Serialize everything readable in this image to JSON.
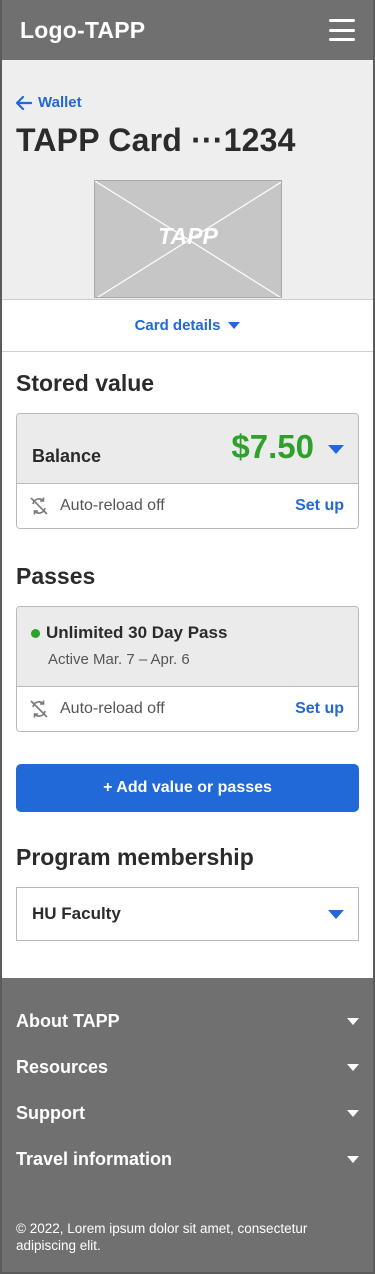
{
  "header": {
    "logo": "Logo-TAPP",
    "menu_icon": "hamburger-menu-icon"
  },
  "hero": {
    "back_label": "Wallet",
    "card_title": "TAPP Card ···1234",
    "card_image_text": "TAPP",
    "details_label": "Card details"
  },
  "stored_value": {
    "heading": "Stored value",
    "balance_label": "Balance",
    "balance_amount": "$7.50",
    "autoreload_text": "Auto-reload off",
    "setup_label": "Set up"
  },
  "passes": {
    "heading": "Passes",
    "pass_name": "Unlimited 30 Day Pass",
    "pass_status": "Active Mar. 7 – Apr. 6",
    "autoreload_text": "Auto-reload off",
    "setup_label": "Set up"
  },
  "add_button": "+ Add value or passes",
  "membership": {
    "heading": "Program membership",
    "selected": "HU Faculty"
  },
  "footer": {
    "items": [
      "About TAPP",
      "Resources",
      "Support",
      "Travel information"
    ],
    "copyright": "© 2022, Lorem ipsum dolor sit amet, consectetur adipiscing elit."
  },
  "colors": {
    "accent": "#2069d6",
    "success": "#2ea12a",
    "header_bg": "#707070"
  }
}
